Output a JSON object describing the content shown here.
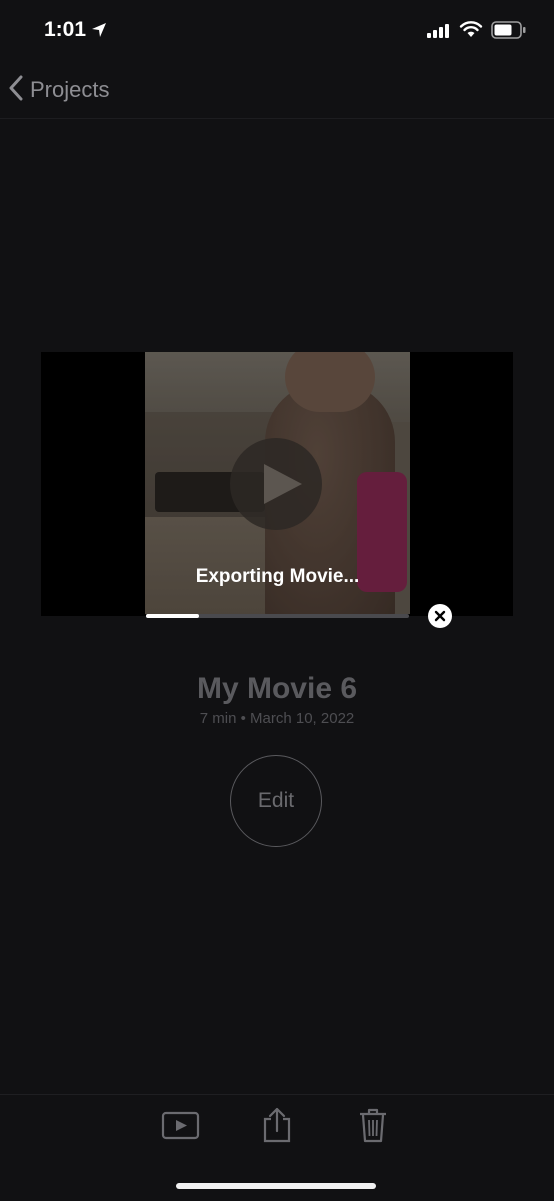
{
  "status_bar": {
    "time": "1:01",
    "icons": [
      "location-arrow-icon",
      "signal-icon",
      "wifi-icon",
      "battery-icon"
    ]
  },
  "nav": {
    "back_label": "Projects",
    "back_icon": "chevron-left-icon"
  },
  "video": {
    "play_icon": "play-icon",
    "export_status": "Exporting Movie...",
    "export_progress": 0.2,
    "cancel_icon": "close-icon"
  },
  "project": {
    "title": "My Movie 6",
    "meta": "7 min • March 10, 2022",
    "edit_label": "Edit"
  },
  "toolbar": {
    "icons": [
      "play-preview-icon",
      "share-icon",
      "trash-icon"
    ]
  },
  "colors": {
    "background": "#111113",
    "secondary_text": "#8e8e93",
    "progress_fill": "#ffffff"
  }
}
